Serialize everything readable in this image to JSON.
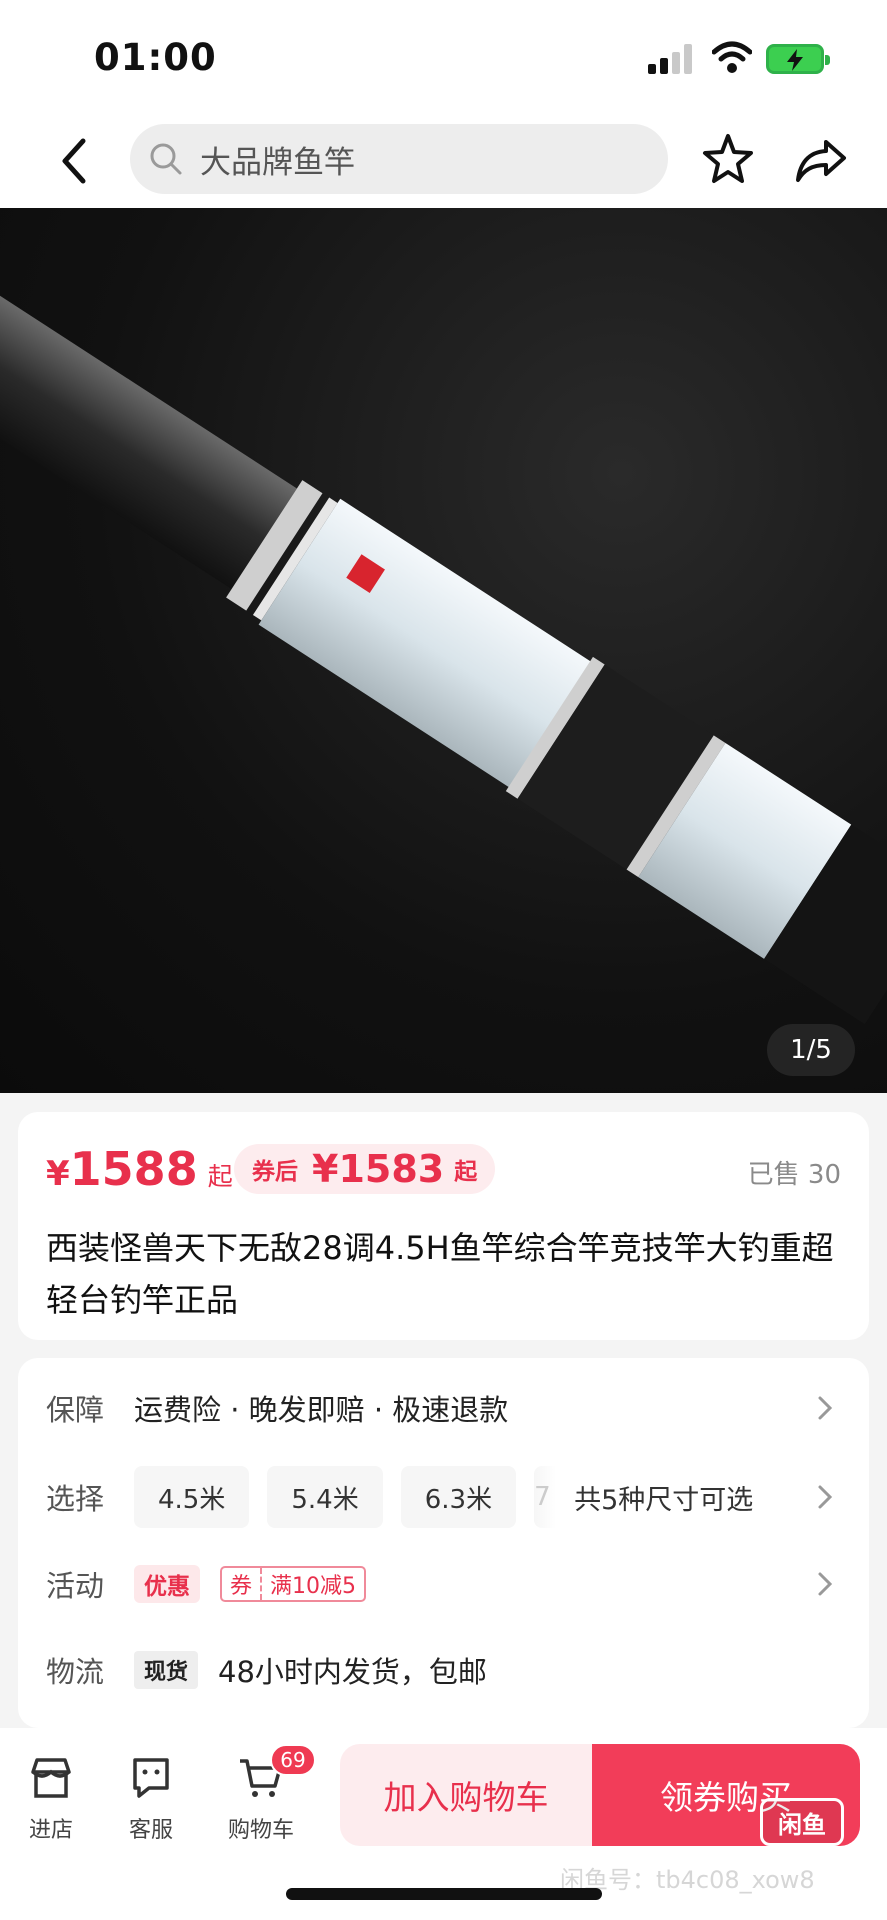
{
  "status_bar": {
    "time": "01:00"
  },
  "search": {
    "query": "大品牌鱼竿"
  },
  "gallery": {
    "page_indicator": "1/5"
  },
  "price": {
    "currency": "¥",
    "value": "1588",
    "qi": "起",
    "coupon_label": "券后",
    "coupon_price": "¥1583",
    "coupon_qi": "起",
    "sold": "已售 30"
  },
  "product": {
    "title": "西装怪兽天下无敌28调4.5H鱼竿综合竿竞技竿大钓重超轻台钓竿正品"
  },
  "info": {
    "guarantee": {
      "label": "保障",
      "text": "运费险 · 晚发即赔 · 极速退款"
    },
    "select": {
      "label": "选择",
      "options": [
        "4.5米",
        "5.4米",
        "6.3米"
      ],
      "partial": "7",
      "summary": "共5种尺寸可选"
    },
    "promo": {
      "label": "活动",
      "tag": "优惠",
      "coupon_left": "券",
      "coupon_right": "满10减5"
    },
    "logistics": {
      "label": "物流",
      "tag": "现货",
      "text": "48小时内发货，包邮"
    }
  },
  "bottom": {
    "store": "进店",
    "service": "客服",
    "cart": "购物车",
    "cart_count": "69",
    "add_to_cart": "加入购物车",
    "buy": "领券购买",
    "logo_text": "闲鱼",
    "watermark": "闲鱼号：tb4c08_xow8"
  },
  "icons": [
    "back-icon",
    "search-icon",
    "star-icon",
    "share-icon",
    "chevron-right-icon",
    "store-icon",
    "service-icon",
    "cart-icon"
  ],
  "colors": {
    "accent": "#e8304c",
    "buy_button": "#f23d59"
  }
}
